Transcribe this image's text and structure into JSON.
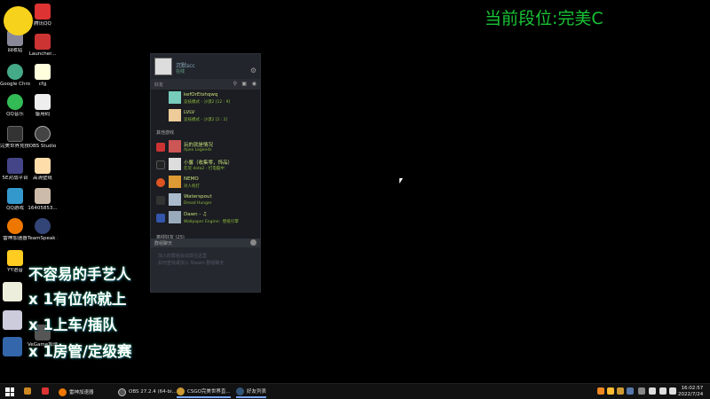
{
  "desktop_icons": [
    {
      "label": "腾讯QQ",
      "color": "#d33"
    },
    {
      "label": "回收站",
      "color": "#889"
    },
    {
      "label": "Launcher...",
      "color": "#c33"
    },
    {
      "label": "Google Chrome",
      "color": "#4a8"
    },
    {
      "label": "cfg",
      "color": "#ffd"
    },
    {
      "label": "QQ音乐",
      "color": "#3b5"
    },
    {
      "label": "备用码",
      "color": "#eee"
    },
    {
      "label": "完美世界竞技平台",
      "color": "#333"
    },
    {
      "label": "OBS Studio",
      "color": "#444"
    },
    {
      "label": "5E对战平台",
      "color": "#448"
    },
    {
      "label": "高清壁纸",
      "color": "#fda"
    },
    {
      "label": "QQ游戏",
      "color": "#39c"
    },
    {
      "label": "16405853...",
      "color": "#cba"
    },
    {
      "label": "雷神加速器",
      "color": "#e70"
    },
    {
      "label": "TeamSpeak 3",
      "color": "#347"
    },
    {
      "label": "YY语音",
      "color": "#fc2"
    },
    {
      "label": "VeGame加速器",
      "color": "#555"
    }
  ],
  "rank_text": "当前段位:完美C",
  "overlay": {
    "line1": "不容易的手艺人",
    "line2": "x 1有位你就上",
    "line3": "x 1上车/插队",
    "line4": "x 1房管/定级赛"
  },
  "steam": {
    "username": "沉默scc",
    "status": "在线",
    "friends_label": "好友",
    "friends_in_game": [
      {
        "name": "kefOrEtshqwq",
        "game": "竞技模式 - 沙漠2 [12 : 9]",
        "color": "#7cb"
      },
      {
        "name": "LVLV",
        "game": "竞技模式 - 沙漠2 [2 : 2]",
        "color": "#ec9"
      }
    ],
    "other_games_label": "其他游戏",
    "other_friends": [
      {
        "name": "玩的就是情况",
        "game": "Apex Legends",
        "color": "#c55"
      },
      {
        "name": "小馨（收集零，饰品）",
        "game": "在玩 dota2 - 打电脑中",
        "color": "#ddd"
      },
      {
        "name": "NEMO",
        "game": "对人机打",
        "color": "#d93"
      },
      {
        "name": "Waterspout",
        "game": "Dread Hunger",
        "color": "#abc"
      },
      {
        "name": "Dawn - ♫",
        "game": "Wallpaper Engine：壁纸引擎",
        "color": "#9ab"
      }
    ],
    "offline_label": "离线好友 (25)",
    "chat_label": "群组聊天",
    "chat_hint1": "加入的群组会出现在这里",
    "chat_hint2": "如何查找或加入 Steam 群组聊天"
  },
  "taskbar": {
    "apps": [
      {
        "label": "雷神加速器",
        "color": "#e70"
      },
      {
        "label": "OBS 27.2.4 (64-bi...",
        "color": "#555"
      },
      {
        "label": "CSGO完美世界直...",
        "color": "#c93"
      },
      {
        "label": "好友列表",
        "color": "#357"
      }
    ],
    "time": "16:02:57",
    "date": "2022/7/24"
  }
}
